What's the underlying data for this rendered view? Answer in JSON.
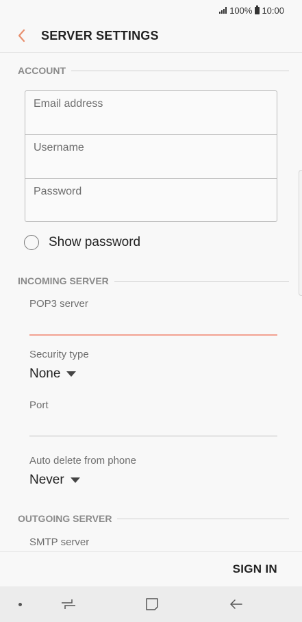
{
  "status_bar": {
    "battery": "100%",
    "time": "10:00"
  },
  "app_bar": {
    "title": "SERVER SETTINGS"
  },
  "account": {
    "header": "ACCOUNT",
    "email_placeholder": "Email address",
    "username_placeholder": "Username",
    "password_placeholder": "Password",
    "show_password_label": "Show password"
  },
  "incoming": {
    "header": "INCOMING SERVER",
    "server_label": "POP3 server",
    "server_value": "",
    "security_label": "Security type",
    "security_value": "None",
    "port_label": "Port",
    "port_value": "",
    "auto_delete_label": "Auto delete from phone",
    "auto_delete_value": "Never"
  },
  "outgoing": {
    "header": "OUTGOING SERVER",
    "server_label": "SMTP server"
  },
  "actions": {
    "sign_in": "SIGN IN"
  },
  "colors": {
    "accent": "#f2a191",
    "back_arrow": "#e8906f"
  }
}
